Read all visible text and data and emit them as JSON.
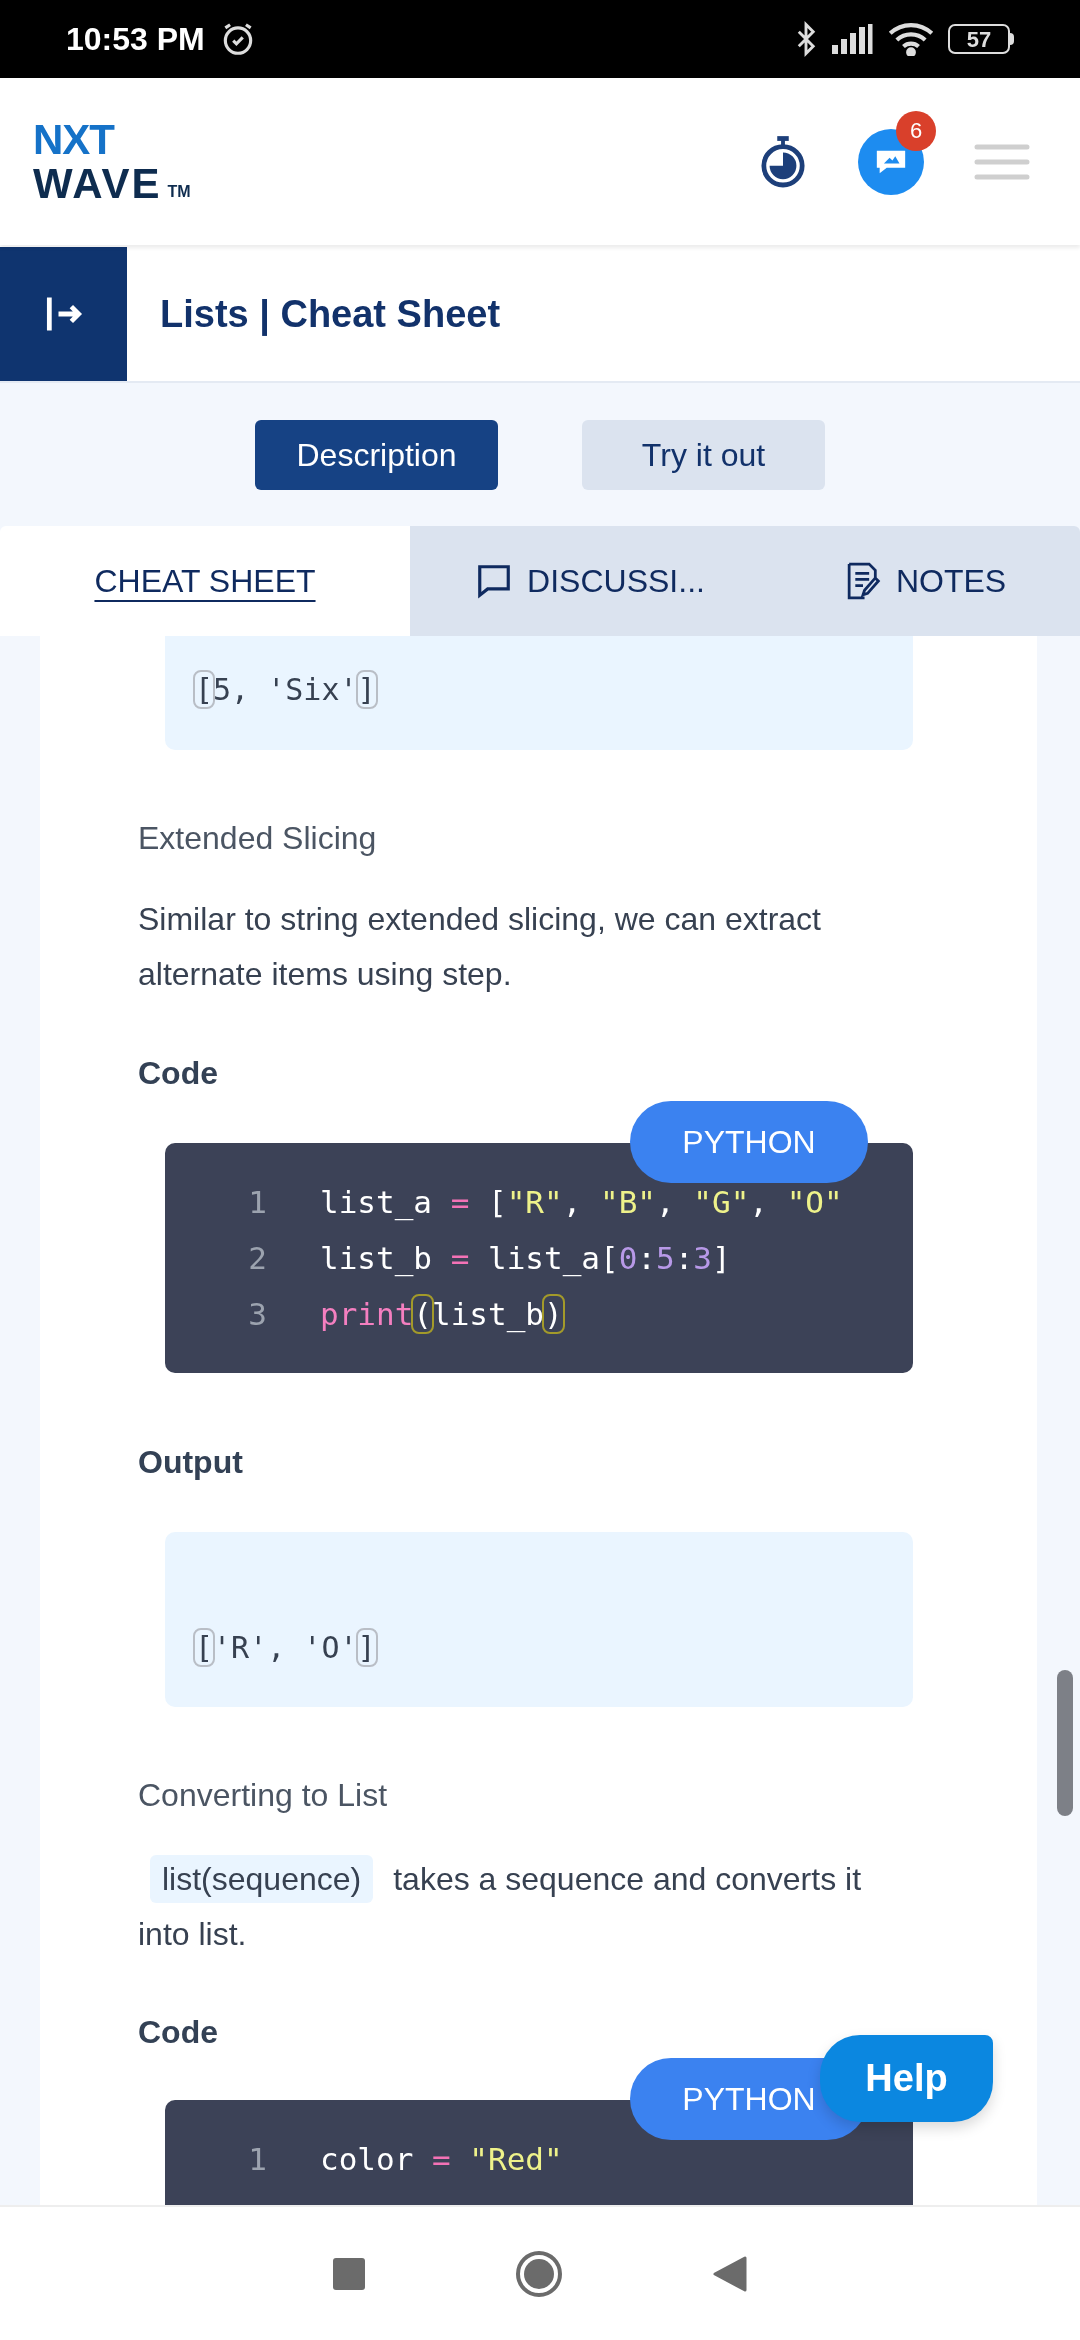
{
  "status_bar": {
    "time": "10:53 PM",
    "battery": "57"
  },
  "header": {
    "logo_top": "NXT",
    "logo_bottom": "WAVE",
    "logo_mark": "TM",
    "notification_count": "6"
  },
  "title_bar": {
    "title": "Lists | Cheat Sheet"
  },
  "view_toggle": [
    {
      "label": "Description",
      "selected": true
    },
    {
      "label": "Try it out",
      "selected": false
    }
  ],
  "tabs": [
    {
      "label": "CHEAT SHEET",
      "selected": true,
      "kind": "plain"
    },
    {
      "label": "DISCUSSI...",
      "selected": false,
      "kind": "chat"
    },
    {
      "label": "NOTES",
      "selected": false,
      "kind": "notes"
    }
  ],
  "content": [
    {
      "kind": "output",
      "cut": true,
      "lines": [
        [
          {
            "text": "[",
            "kind": "match_gray"
          },
          {
            "text": "5, 'Six'",
            "kind": "plain"
          },
          {
            "text": "]",
            "kind": "match_gray"
          }
        ]
      ]
    },
    {
      "kind": "subheading",
      "text": "Extended Slicing"
    },
    {
      "kind": "paragraph",
      "text": "Similar to string extended slicing, we can extract alternate items using step."
    },
    {
      "kind": "label",
      "text": "Code"
    },
    {
      "kind": "code",
      "language": "PYTHON",
      "lines": [
        {
          "number": "1",
          "tokens": [
            {
              "text": "list_a ",
              "kind": "plain"
            },
            {
              "text": "=",
              "kind": "op"
            },
            {
              "text": " [",
              "kind": "plain"
            },
            {
              "text": "\"R\"",
              "kind": "str"
            },
            {
              "text": ", ",
              "kind": "plain"
            },
            {
              "text": "\"B\"",
              "kind": "str"
            },
            {
              "text": ", ",
              "kind": "plain"
            },
            {
              "text": "\"G\"",
              "kind": "str"
            },
            {
              "text": ", ",
              "kind": "plain"
            },
            {
              "text": "\"O\"",
              "kind": "str"
            }
          ]
        },
        {
          "number": "2",
          "tokens": [
            {
              "text": "list_b ",
              "kind": "plain"
            },
            {
              "text": "=",
              "kind": "op"
            },
            {
              "text": " list_a[",
              "kind": "plain"
            },
            {
              "text": "0",
              "kind": "num"
            },
            {
              "text": ":",
              "kind": "plain"
            },
            {
              "text": "5",
              "kind": "num"
            },
            {
              "text": ":",
              "kind": "plain"
            },
            {
              "text": "3",
              "kind": "num"
            },
            {
              "text": "]",
              "kind": "plain"
            }
          ]
        },
        {
          "number": "3",
          "tokens": [
            {
              "text": "print",
              "kind": "kw"
            },
            {
              "text": "(",
              "kind": "match_yellow"
            },
            {
              "text": "list_b",
              "kind": "plain"
            },
            {
              "text": ")",
              "kind": "match_yellow"
            }
          ]
        }
      ]
    },
    {
      "kind": "label",
      "text": "Output"
    },
    {
      "kind": "output",
      "cut": false,
      "lines": [
        [
          {
            "text": "[",
            "kind": "match_gray"
          },
          {
            "text": "'R', 'O'",
            "kind": "plain"
          },
          {
            "text": "]",
            "kind": "match_gray"
          }
        ]
      ]
    },
    {
      "kind": "subheading",
      "text": "Converting to List"
    },
    {
      "kind": "code_paragraph",
      "code": "list(sequence)",
      "text": "takes a sequence and converts it into list."
    },
    {
      "kind": "label",
      "text": "Code"
    },
    {
      "kind": "code",
      "language": "PYTHON",
      "lines": [
        {
          "number": "1",
          "tokens": [
            {
              "text": "color ",
              "kind": "plain"
            },
            {
              "text": "=",
              "kind": "op"
            },
            {
              "text": " \"Red\"",
              "kind": "str"
            }
          ]
        }
      ]
    }
  ],
  "help_button": "Help"
}
